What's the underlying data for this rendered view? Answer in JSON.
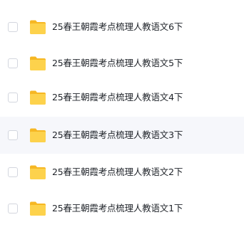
{
  "file_list": {
    "items": [
      {
        "name": "25春王朝霞考点梳理人教语文6下",
        "icon": "folder-icon",
        "hovered": false
      },
      {
        "name": "25春王朝霞考点梳理人教语文5下",
        "icon": "folder-icon",
        "hovered": false
      },
      {
        "name": "25春王朝霞考点梳理人教语文4下",
        "icon": "folder-icon",
        "hovered": false
      },
      {
        "name": "25春王朝霞考点梳理人教语文3下",
        "icon": "folder-icon",
        "hovered": true
      },
      {
        "name": "25春王朝霞考点梳理人教语文2下",
        "icon": "folder-icon",
        "hovered": false
      },
      {
        "name": "25春王朝霞考点梳理人教语文1下",
        "icon": "folder-icon",
        "hovered": false
      }
    ]
  },
  "colors": {
    "folder_back": "#f6b723",
    "folder_front": "#fdd24c",
    "hover_background": "#f6f7fb",
    "text": "#1f2329",
    "checkbox_border": "#d3d6de"
  }
}
